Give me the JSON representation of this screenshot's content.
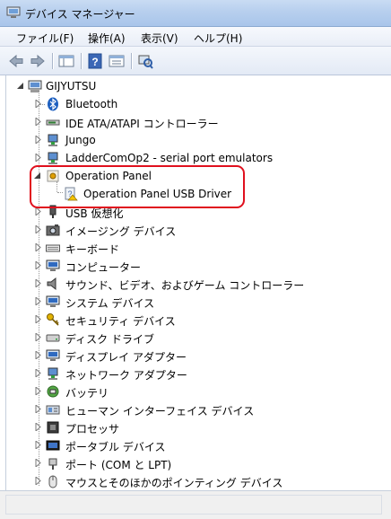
{
  "window": {
    "title": "デバイス マネージャー"
  },
  "menu": {
    "file": "ファイル(F)",
    "action": "操作(A)",
    "view": "表示(V)",
    "help": "ヘルプ(H)"
  },
  "tree": {
    "root": "GIJYUTSU",
    "items": [
      {
        "label": "Bluetooth",
        "icon": "bluetooth-icon"
      },
      {
        "label": "IDE ATA/ATAPI コントローラー",
        "icon": "ide-controller-icon"
      },
      {
        "label": "Jungo",
        "icon": "jungo-icon"
      },
      {
        "label": "LadderComOp2 - serial port emulators",
        "icon": "serial-port-icon"
      },
      {
        "label": "Operation Panel",
        "icon": "operation-panel-icon",
        "expanded": true,
        "children": [
          {
            "label": "Operation Panel USB Driver",
            "icon": "unknown-device-warning-icon"
          }
        ]
      },
      {
        "label": "USB 仮想化",
        "icon": "usb-icon"
      },
      {
        "label": "イメージング デバイス",
        "icon": "camera-icon"
      },
      {
        "label": "キーボード",
        "icon": "keyboard-icon"
      },
      {
        "label": "コンピューター",
        "icon": "computer-icon"
      },
      {
        "label": "サウンド、ビデオ、およびゲーム コントローラー",
        "icon": "speaker-icon"
      },
      {
        "label": "システム デバイス",
        "icon": "system-device-icon"
      },
      {
        "label": "セキュリティ デバイス",
        "icon": "key-icon"
      },
      {
        "label": "ディスク ドライブ",
        "icon": "disk-drive-icon"
      },
      {
        "label": "ディスプレイ アダプター",
        "icon": "display-adapter-icon"
      },
      {
        "label": "ネットワーク アダプター",
        "icon": "network-adapter-icon"
      },
      {
        "label": "バッテリ",
        "icon": "battery-icon"
      },
      {
        "label": "ヒューマン インターフェイス デバイス",
        "icon": "hid-icon"
      },
      {
        "label": "プロセッサ",
        "icon": "processor-icon"
      },
      {
        "label": "ポータブル デバイス",
        "icon": "portable-device-icon"
      },
      {
        "label": "ポート (COM と LPT)",
        "icon": "port-icon"
      },
      {
        "label": "マウスとそのほかのポインティング デバイス",
        "icon": "mouse-icon"
      }
    ]
  },
  "colors": {
    "highlight": "#e0101e",
    "titlebar": "#b7cfee"
  }
}
